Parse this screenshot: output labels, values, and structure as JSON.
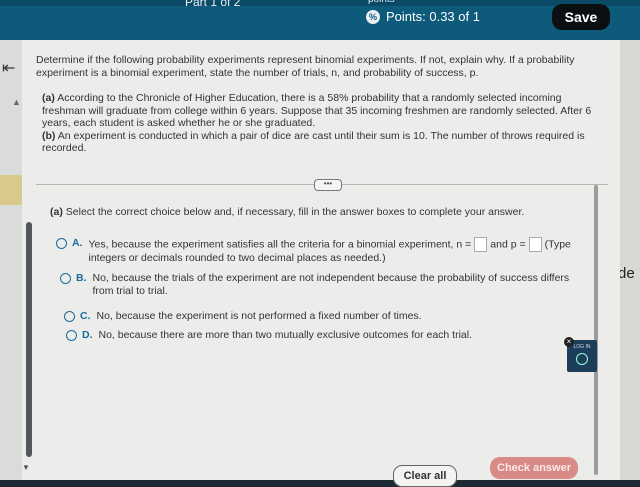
{
  "header": {
    "part_label": "Part 1 of 2",
    "points_top_label": "points",
    "points_label": "Points: 0.33 of 1",
    "save_label": "Save"
  },
  "question": {
    "intro": "Determine if the following probability experiments represent binomial experiments. If not, explain why. If a probability experiment is a binomial experiment, state the number of trials, n, and probability of success, p.",
    "part_a_tag": "(a)",
    "part_a": "According to the Chronicle of Higher Education, there is a 58% probability that a randomly selected incoming freshman will graduate from college within 6 years. Suppose that 35 incoming freshmen are randomly selected. After 6 years, each student is asked whether he or she graduated.",
    "part_b_tag": "(b)",
    "part_b": "An experiment is conducted in which a pair of dice are cast until their sum is 10. The number of throws required is recorded."
  },
  "collapse_label": "•••",
  "answer": {
    "subprompt_tag": "(a)",
    "subprompt": "Select the correct choice below and, if necessary, fill in the answer boxes to complete your answer.",
    "options": [
      {
        "letter": "A.",
        "text_1": "Yes, because the experiment satisfies all the criteria for a binomial experiment, n =",
        "text_2": "and p =",
        "text_3": "(Type integers or decimals rounded to two decimal places as needed.)"
      },
      {
        "letter": "B.",
        "text": "No, because the trials of the experiment are not independent because the probability of success differs from trial to trial."
      },
      {
        "letter": "C.",
        "text": "No, because the experiment is not performed a fixed number of times."
      },
      {
        "letter": "D.",
        "text": "No, because there are more than two mutually exclusive outcomes for each trial."
      }
    ]
  },
  "widget": {
    "label": "LOG IN",
    "close": "×"
  },
  "footer": {
    "clear_label": "Clear all",
    "check_label": "Check answer"
  },
  "side_text": "de",
  "colors": {
    "header": "#0d5a7a",
    "accent": "#1b6a9a",
    "check_button": "#d88a86"
  }
}
